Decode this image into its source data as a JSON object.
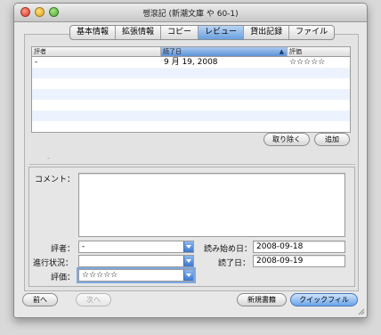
{
  "window": {
    "title": "쨍滾記 (新潮文庫 や 60-1)"
  },
  "tabs": [
    {
      "label": "基本情報",
      "active": false
    },
    {
      "label": "拡張情報",
      "active": false
    },
    {
      "label": "コピー",
      "active": false
    },
    {
      "label": "レビュー",
      "active": true
    },
    {
      "label": "貸出記録",
      "active": false
    },
    {
      "label": "ファイル",
      "active": false
    }
  ],
  "review_table": {
    "columns": [
      "評者",
      "読了日",
      "評価"
    ],
    "sorted_column": "読了日",
    "rows": [
      {
        "reviewer": "-",
        "date_finished": "9 月 19, 2008",
        "rating": "☆☆☆☆☆"
      }
    ]
  },
  "table_buttons": {
    "remove": "取り除く",
    "add": "追加"
  },
  "detail": {
    "comment_label": "コメント：",
    "comment_value": "",
    "reviewer_label": "評者：",
    "reviewer_value": "-",
    "progress_label": "進行状況：",
    "progress_value": "",
    "rating_label": "評価：",
    "rating_value": "☆☆☆☆☆",
    "start_label": "読み始め日：",
    "start_value": "2008-09-18",
    "finish_label": "読了日：",
    "finish_value": "2008-09-19"
  },
  "footer": {
    "prev": "前へ",
    "next": "次へ",
    "new_record": "新規書籍",
    "quickfill": "クイックフィル"
  },
  "colors": {
    "accent": "#6a9fe0",
    "row_alt": "#edf3fe"
  },
  "icons": [
    "close-light-icon",
    "minimize-light-icon",
    "zoom-light-icon",
    "sort-arrow-icon",
    "popup-arrow-icon",
    "resize-grip-icon"
  ]
}
